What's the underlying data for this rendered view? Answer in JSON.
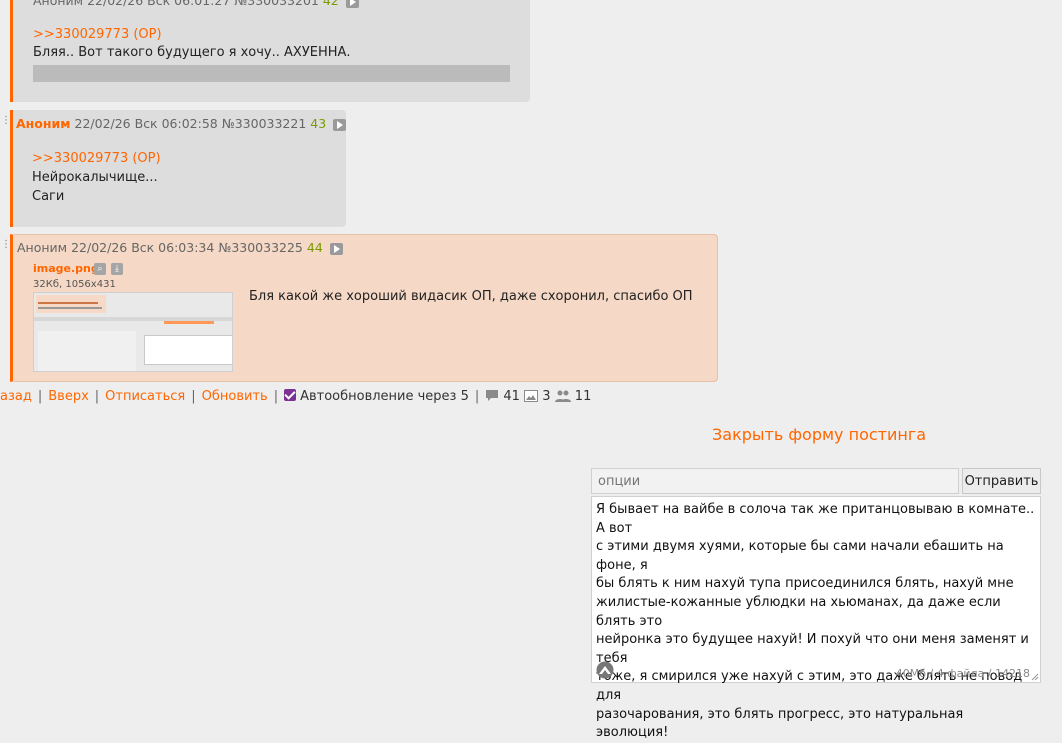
{
  "posts": [
    {
      "header_partial": "Аноним 22/02/26 Вск 06:01:27 №330033201",
      "count": "42",
      "reply_link": ">>330029773 (OP)",
      "lines": [
        "Бляя.. Вот такого будущего я хочу.. АХУЕННА."
      ]
    },
    {
      "name": "Аноним",
      "datetime": "22/02/26 Вск 06:02:58",
      "number": "№330033221",
      "count": "43",
      "reply_link": ">>330029773 (OP)",
      "lines": [
        "Нейрокалычище...",
        "Саги"
      ]
    },
    {
      "name": "Аноним",
      "datetime": "22/02/26 Вск 06:03:34",
      "number": "№330033225",
      "count": "44",
      "file": {
        "name": "image.png",
        "meta": "32Кб, 1056x431"
      },
      "lines": [
        "Бля какой же хороший видасик ОП, даже схоронил, спасибо ОП"
      ]
    }
  ],
  "nav": {
    "back": "азад",
    "top": "Вверх",
    "unsubscribe": "Отписаться",
    "refresh": "Обновить",
    "autoupdate": "Автообновление через 5",
    "posts_count": "41",
    "images_count": "3",
    "users_count": "11"
  },
  "form": {
    "close_label": "Закрыть форму постинга",
    "options_placeholder": "опции",
    "send_label": "Отправить",
    "message": "Я бывает на вайбе в солоча так же пританцовываю в комнате.. А вот\nс этими двумя хуями, которые бы сами начали ебашить на фоне, я\nбы блять к ним нахуй тупа присоединился блять, нахуй мне\nжилистые-кожанные ублюдки на хьюманах, да даже если блять это\nнейронка это будущее нахуй! И похуй что они меня заменят и тебя\nтоже, я смирился уже нахуй с этим, это даже блять не повод для\nразочарования, это блять прогресс, это натуральная эволюция!",
    "counter": "40Мб / 4 файла / 14218"
  },
  "colors": {
    "accent": "#ff6600",
    "post_bg": "#dddddd",
    "op_reply_bg": "#f5d8c5",
    "checkbox": "#7b3294",
    "count": "#7a9b00"
  }
}
